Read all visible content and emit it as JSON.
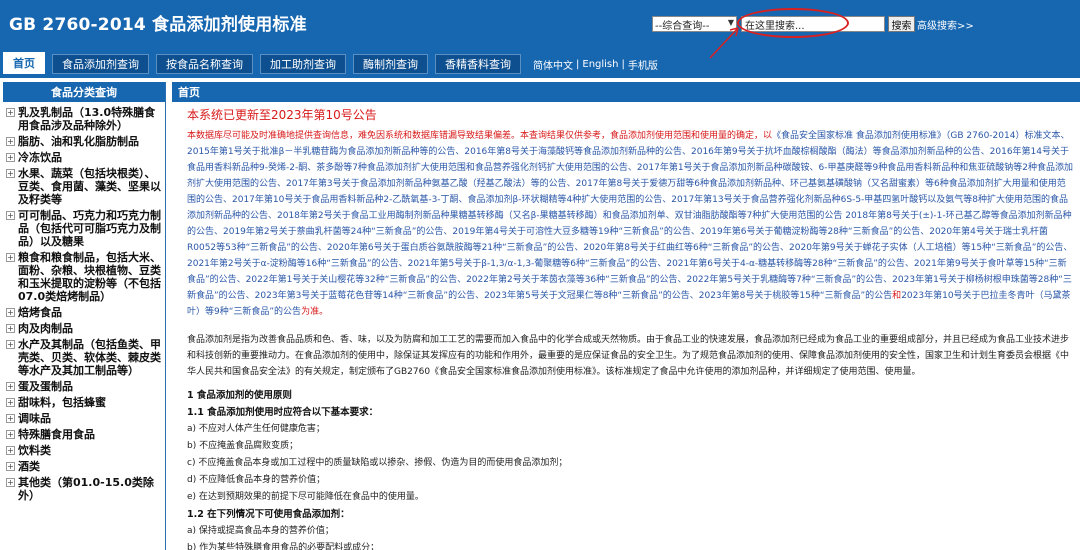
{
  "header": {
    "title": "GB 2760-2014 食品添加剂使用标准",
    "search_select": "--综合查询--",
    "search_placeholder": "在这里搜索...",
    "search_button": "搜索",
    "advanced_search": "高级搜索>>",
    "highlight_color": "#d82020"
  },
  "nav": {
    "tabs": [
      {
        "label": "首页"
      },
      {
        "label": "食品添加剂查询"
      },
      {
        "label": "按食品名称查询"
      },
      {
        "label": "加工助剂查询"
      },
      {
        "label": "酶制剂查询"
      },
      {
        "label": "香精香料查询"
      }
    ],
    "lang": {
      "zh": "简体中文",
      "en": "English",
      "mobile": "手机版"
    }
  },
  "sidebar": {
    "title": "食品分类查询",
    "categories": [
      "乳及乳制品（13.0特殊膳食用食品涉及品种除外）",
      "脂肪、油和乳化脂肪制品",
      "冷冻饮品",
      "水果、蔬菜（包括块根类）、豆类、食用菌、藻类、坚果以及籽类等",
      "可可制品、巧克力和巧克力制品（包括代可可脂巧克力及制品）以及糖果",
      "粮食和粮食制品，包括大米、面粉、杂粮、块根植物、豆类和玉米提取的淀粉等（不包括07.0类焙烤制品）",
      "焙烤食品",
      "肉及肉制品",
      "水产及其制品（包括鱼类、甲壳类、贝类、软体类、棘皮类等水产及其加工制品等）",
      "蛋及蛋制品",
      "甜味料，包括蜂蜜",
      "调味品",
      "特殊膳食用食品",
      "饮料类",
      "酒类",
      "其他类（第01.0-15.0类除外）"
    ]
  },
  "main": {
    "title": "首页",
    "update_notice": "本系统已更新至2023年第10号公告",
    "disclaimer_red": "本数据库尽可能及时准确地提供查询信息，难免因系统和数据库错漏导致结果偏差。本查询结果仅供参考，食品添加剂使用范围和使用量的确定，以",
    "disclaimer_blue": "《食品安全国家标准 食品添加剂使用标准》（GB 2760-2014）标准文本、2015年第1号关于批准β－半乳糖苷酶为食品添加剂新品种等的公告、2016年第8号关于海藻酸钙等食品添加剂新品种的公告、2016年第9号关于抗坏血酸棕榈酸酯（酶法）等食品添加剂新品种的公告、2016年第14号关于食品用香料新品种9-癸烯-2-酮、茶多酚等7种食品添加剂扩大使用范围和食品营养强化剂钙扩大使用范围的公告、2017年第1号关于食品添加剂新品种碳酸铵、6-甲基庚醛等9种食品用香料新品种和焦亚硫酸钠等2种食品添加剂扩大使用范围的公告、2017年第3号关于食品添加剂新品种氨基乙酸（羟基乙酸法）等的公告、2017年第8号关于爱德万甜等6种食品添加剂新品种、环己基氨基磺酸钠（又名甜蜜素）等6种食品添加剂扩大用量和使用范围的公告、2017年第10号关于食品用香料新品种2-乙酰氧基-3-丁酮、食品添加剂β-环状糊精等4种扩大使用范围的公告、2017年第13号关于食品营养强化剂新品种6S-5-甲基四氢叶酸钙以及氨气等8种扩大使用范围的食品添加剂新品种的公告、2018年第2号关于食品工业用酶制剂新品种果糖基转移酶（又名β-果糖基转移酶）和食品添加剂单、双甘油脂肪酸酯等7种扩大使用范围的公告 2018年第8号关于(±)-1-环己基乙醇等食品添加剂新品种的公告、2019年第2号关于萘曲乳杆菌等24种“三新食品”的公告、2019年第4号关于可溶性大豆多糖等19种“三新食品”的公告、2019年第6号关于葡糖淀粉酶等28种“三新食品”的公告、2020年第4号关于瑞士乳杆菌R0052等53种“三新食品”的公告、2020年第6号关于蛋白质谷氨酰胺酶等21种“三新食品”的公告、2020年第8号关于红曲红等6种“三新食品”的公告、2020年第9号关于蝉花子实体（人工培植）等15种“三新食品”的公告、2021年第2号关于α-淀粉酶等16种“三新食品”的公告、2021年第5号关于β-1,3/α-1,3-葡聚糖等6种“三新食品”的公告、2021年第6号关于4-α-糖基转移酶等28种“三新食品”的公告、2021年第9号关于食叶草等15种“三新食品”的公告、2022年第1号关于关山樱花等32种“三新食品”的公告、2022年第2号关于苯茵衣藻等36种“三新食品”的公告、2022年第5号关于乳糖酶等7种“三新食品”的公告、2023年第1号关于柳杨树根申珠菌等28种“三新食品”的公告、2023年第3号关于蓝莓花色苷等14种“三新食品”的公告、2023年第5号关于文冠果仁等8种“三新食品”的公告、2023年第8号关于桃胶等15种“三新食品”的公告",
    "disclaimer_and": "和",
    "disclaimer_blue2": "2023年第10号关于巴拉圭冬青叶（马黛茶叶）等9种“三新食品”的公告",
    "disclaimer_end": "为准。",
    "intro": "食品添加剂是指为改善食品品质和色、香、味，以及为防腐和加工工艺的需要而加入食品中的化学合成或天然物质。由于食品工业的快速发展，食品添加剂已经成为食品工业的重要组成部分，并且已经成为食品工业技术进步和科技创新的重要推动力。在食品添加剂的使用中，除保证其发挥应有的功能和作用外，最重要的是应保证食品的安全卫生。为了规范食品添加剂的使用、保障食品添加剂使用的安全性，国家卫生和计划生育委员会根据《中华人民共和国食品安全法》的有关规定，制定颁布了GB2760《食品安全国家标准食品添加剂使用标准》。该标准规定了食品中允许使用的添加剂品种，并详细规定了使用范围、使用量。",
    "section1_title": "1 食品添加剂的使用原则",
    "section11_title": "1.1 食品添加剂使用时应符合以下基本要求：",
    "section11_items": [
      "a) 不应对人体产生任何健康危害；",
      "b) 不应掩盖食品腐败变质；",
      "c) 不应掩盖食品本身或加工过程中的质量缺陷或以掺杂、掺假、伪造为目的而使用食品添加剂；",
      "d) 不应降低食品本身的营养价值；",
      "e) 在达到预期效果的前提下尽可能降低在食品中的使用量。"
    ],
    "section12_title": "1.2 在下列情况下可使用食品添加剂：",
    "section12_items": [
      "a) 保持或提高食品本身的营养价值；",
      "b) 作为某些特殊膳食用食品的必要配料或成分；"
    ]
  }
}
